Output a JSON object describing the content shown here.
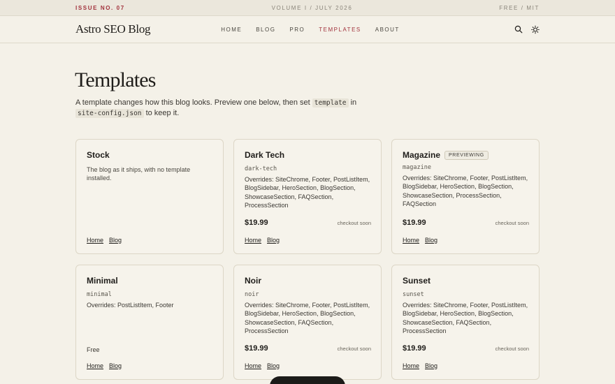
{
  "topbar": {
    "issue": "ISSUE NO. 07",
    "volume": "VOLUME I / JULY 2026",
    "license": "FREE / MIT"
  },
  "header": {
    "logo": "Astro SEO Blog",
    "nav": [
      {
        "label": "HOME",
        "active": false
      },
      {
        "label": "BLOG",
        "active": false
      },
      {
        "label": "PRO",
        "active": false
      },
      {
        "label": "TEMPLATES",
        "active": true
      },
      {
        "label": "ABOUT",
        "active": false
      }
    ],
    "icons": [
      "search-icon",
      "sun-icon"
    ]
  },
  "page": {
    "title": "Templates",
    "intro_before": "A template changes how this blog looks. Preview one below, then set ",
    "intro_code1": "template",
    "intro_mid": " in ",
    "intro_code2": "site-config.json",
    "intro_after": " to keep it."
  },
  "cards": [
    {
      "name": "Stock",
      "description": "The blog as it ships, with no template installed.",
      "links": [
        "Home",
        "Blog"
      ]
    },
    {
      "name": "Dark Tech",
      "slug": "dark-tech",
      "overrides": "Overrides: SiteChrome, Footer, PostListItem, BlogSidebar, HeroSection, BlogSection, ShowcaseSection, FAQSection, ProcessSection",
      "price": "$19.99",
      "status": "checkout soon",
      "links": [
        "Home",
        "Blog"
      ]
    },
    {
      "name": "Magazine",
      "badge": "PREVIEWING",
      "slug": "magazine",
      "overrides": "Overrides: SiteChrome, Footer, PostListItem, BlogSidebar, HeroSection, BlogSection, ShowcaseSection, ProcessSection, FAQSection",
      "price": "$19.99",
      "status": "checkout soon",
      "links": [
        "Home",
        "Blog"
      ]
    },
    {
      "name": "Minimal",
      "slug": "minimal",
      "overrides": "Overrides: PostListItem, Footer",
      "price_label": "Free",
      "links": [
        "Home",
        "Blog"
      ]
    },
    {
      "name": "Noir",
      "slug": "noir",
      "overrides": "Overrides: SiteChrome, Footer, PostListItem, BlogSidebar, HeroSection, BlogSection, ShowcaseSection, FAQSection, ProcessSection",
      "price": "$19.99",
      "status": "checkout soon",
      "links": [
        "Home",
        "Blog"
      ]
    },
    {
      "name": "Sunset",
      "slug": "sunset",
      "overrides": "Overrides: SiteChrome, Footer, PostListItem, BlogSidebar, HeroSection, BlogSection, ShowcaseSection, FAQSection, ProcessSection",
      "price": "$19.99",
      "status": "checkout soon",
      "links": [
        "Home",
        "Blog"
      ]
    }
  ],
  "colors": {
    "accent": "#a2333d",
    "background": "#f4f1e8",
    "card_border": "#dcd6c6"
  }
}
